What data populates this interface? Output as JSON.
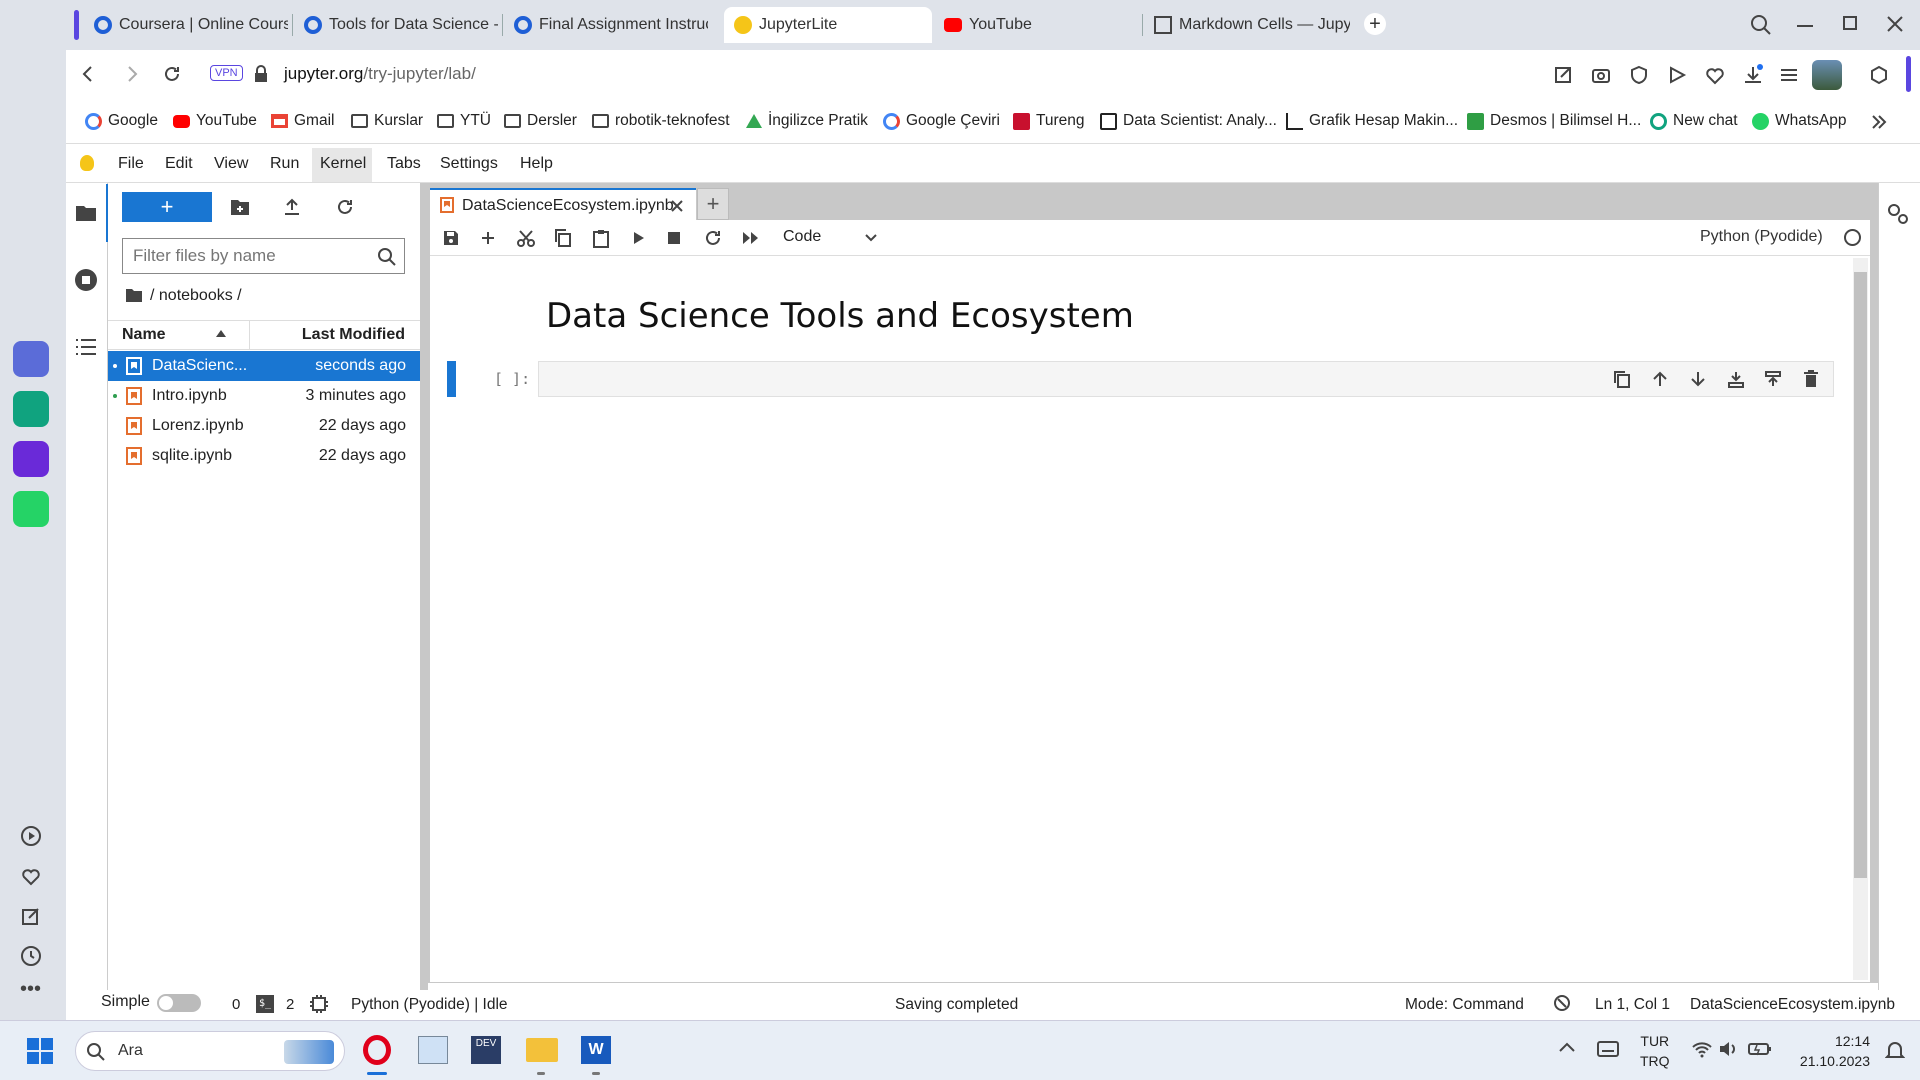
{
  "browser": {
    "tabs": [
      {
        "title": "Coursera | Online Courses",
        "active": false
      },
      {
        "title": "Tools for Data Science - C",
        "active": false
      },
      {
        "title": "Final Assignment Instructi",
        "active": false
      },
      {
        "title": "JupyterLite",
        "active": true
      },
      {
        "title": "YouTube",
        "active": false
      },
      {
        "title": "Markdown Cells — Jupyte",
        "active": false
      }
    ],
    "vpn_label": "VPN",
    "url_domain": "jupyter.org",
    "url_path": "/try-jupyter/lab/",
    "bookmarks": [
      "Google",
      "YouTube",
      "Gmail",
      "Kurslar",
      "YTÜ",
      "Dersler",
      "robotik-teknofest",
      "İngilizce Pratik",
      "Google Çeviri",
      "Tureng",
      "Data Scientist: Analy...",
      "Grafik Hesap Makin...",
      "Desmos | Bilimsel H...",
      "New chat",
      "WhatsApp"
    ]
  },
  "jupyter": {
    "menu": [
      "File",
      "Edit",
      "View",
      "Run",
      "Kernel",
      "Tabs",
      "Settings",
      "Help"
    ],
    "filebrowser": {
      "new_label": "+",
      "filter_placeholder": "Filter files by name",
      "breadcrumb": "/ notebooks /",
      "col_name": "Name",
      "col_modified": "Last Modified",
      "files": [
        {
          "name": "DataScienc...",
          "modified": "seconds ago",
          "selected": true,
          "running": true
        },
        {
          "name": "Intro.ipynb",
          "modified": "3 minutes ago",
          "selected": false,
          "running": true
        },
        {
          "name": "Lorenz.ipynb",
          "modified": "22 days ago",
          "selected": false,
          "running": false
        },
        {
          "name": "sqlite.ipynb",
          "modified": "22 days ago",
          "selected": false,
          "running": false
        }
      ]
    },
    "notebook": {
      "tab_title": "DataScienceEcosystem.ipynb",
      "cell_type": "Code",
      "kernel_name": "Python (Pyodide)",
      "heading": "Data Science Tools and Ecosystem",
      "cell_prompt": "[ ]:"
    },
    "status": {
      "mode_label": "Simple",
      "terminals": "0",
      "kernels": "2",
      "kernel_status": "Python (Pyodide) | Idle",
      "message": "Saving completed",
      "mode": "Mode: Command",
      "cursor": "Ln 1, Col 1",
      "file": "DataScienceEcosystem.ipynb"
    }
  },
  "taskbar": {
    "search_placeholder": "Ara",
    "lang1": "TUR",
    "lang2": "TRQ",
    "time": "12:14",
    "date": "21.10.2023"
  },
  "colors": {
    "accent": "#1976d2",
    "opera": "#e0001b",
    "jupyter_orange": "#e46e2e"
  }
}
